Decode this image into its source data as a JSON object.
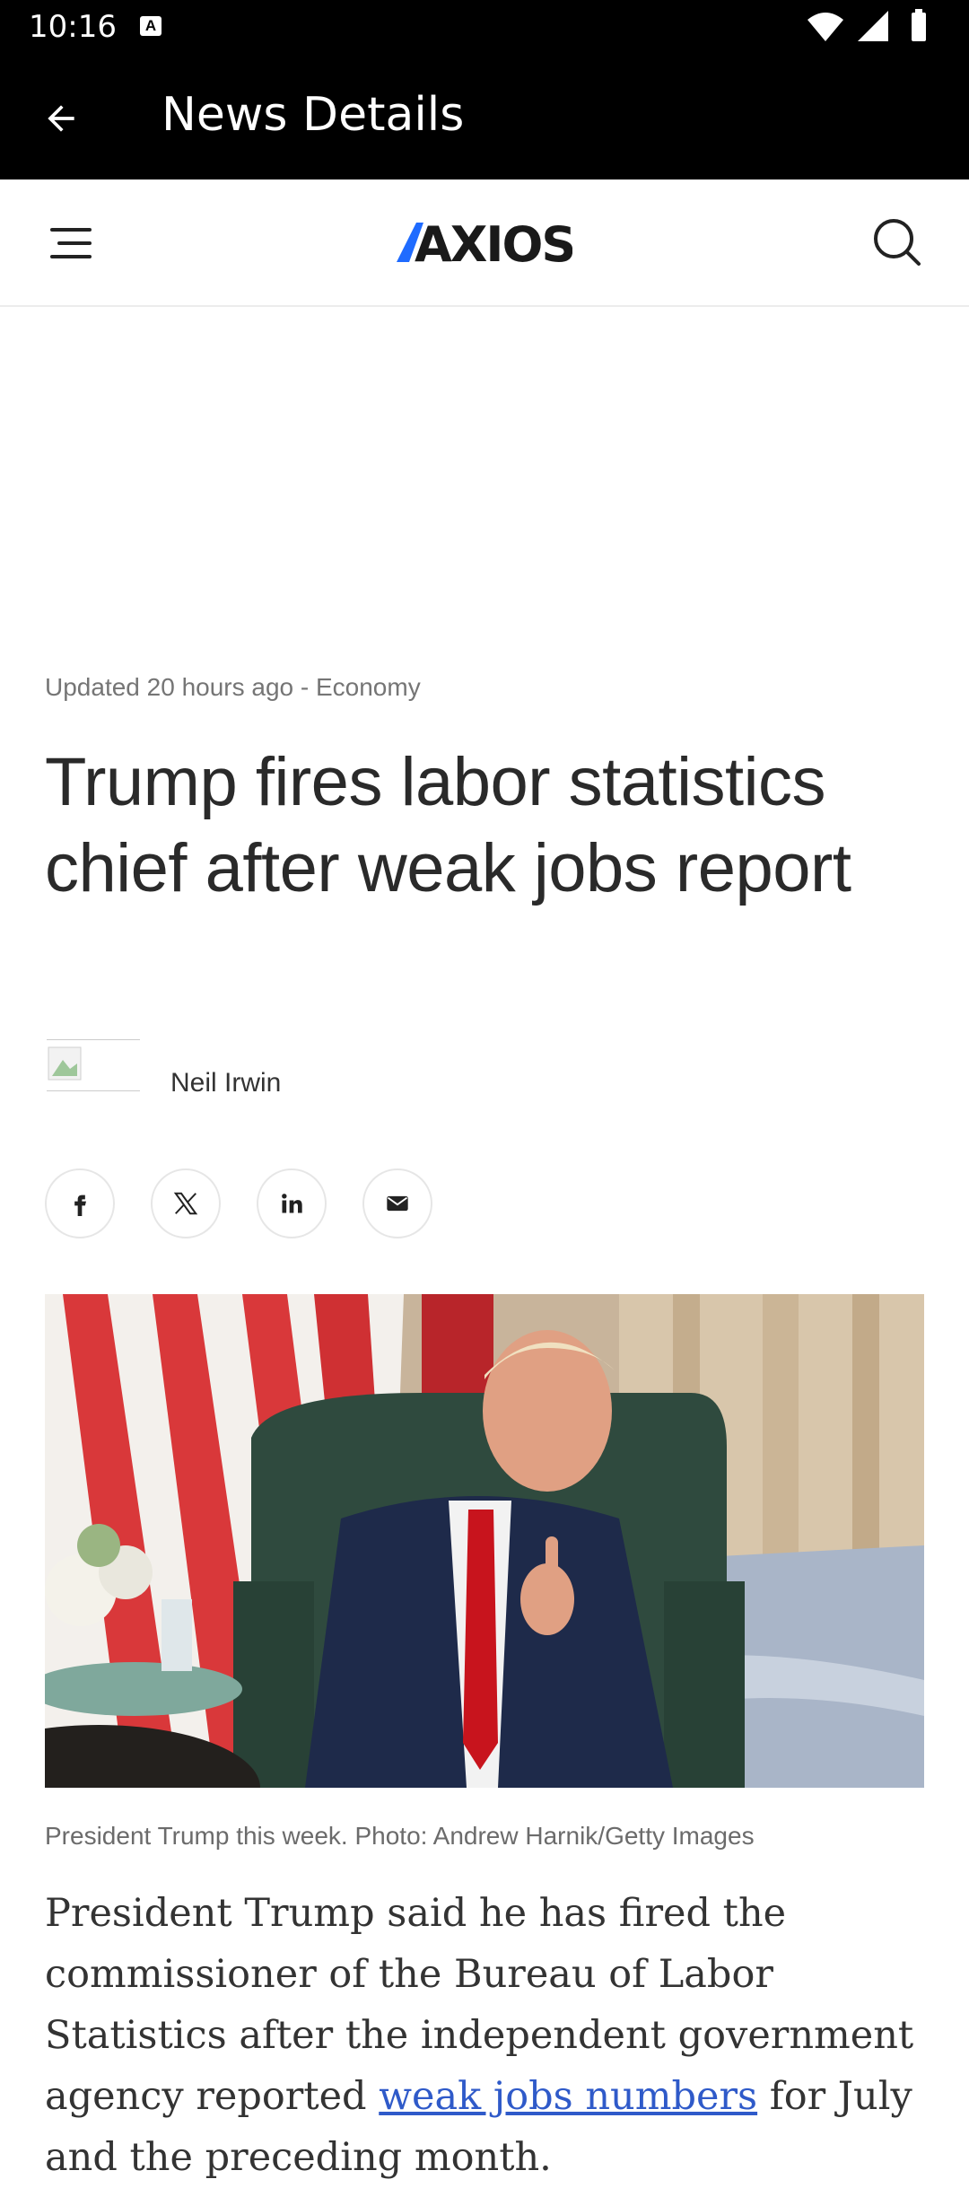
{
  "status_bar": {
    "time": "10:16",
    "notification_icon": "a-box-icon",
    "icons": [
      "wifi-icon",
      "signal-icon",
      "battery-icon"
    ]
  },
  "app_bar": {
    "title": "News Details",
    "back_icon": "arrow-left-icon"
  },
  "site_header": {
    "logo_text": "AXIOS",
    "menu_icon": "hamburger-icon",
    "search_icon": "search-icon"
  },
  "article": {
    "meta": "Updated 20 hours ago - Economy",
    "headline": "Trump fires labor statistics chief after weak jobs report",
    "author": "Neil Irwin",
    "share": [
      "facebook-icon",
      "x-icon",
      "linkedin-icon",
      "email-icon"
    ],
    "caption": "President Trump this week. Photo: Andrew Harnik/Getty Images",
    "body_before_link": "President Trump said he has fired the commissioner of the Bureau of Labor Statistics after the independent government agency reported ",
    "body_link": "weak jobs numbers",
    "body_after_link": " for July and the preceding month."
  },
  "colors": {
    "appbar": "#000000",
    "logo": "#1a1a1a",
    "logo_accent": "#1f6bff",
    "link": "#2f5ac9",
    "meta": "#757575"
  }
}
